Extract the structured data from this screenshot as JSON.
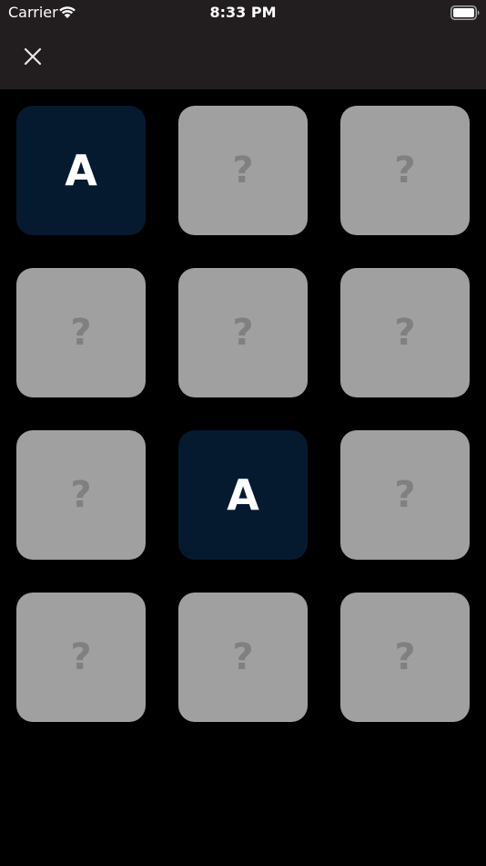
{
  "status_bar": {
    "carrier": "Carrier",
    "time": "8:33 PM",
    "wifi_icon": "wifi-icon",
    "battery_icon": "battery-icon"
  },
  "header": {
    "close_icon": "close-icon"
  },
  "colors": {
    "header_bg": "#221e1f",
    "page_bg": "#000000",
    "hidden_card": "#a0a0a0",
    "hidden_mark": "#808080",
    "revealed_card": "#061a2f",
    "revealed_text": "#ffffff"
  },
  "board": {
    "rows": 4,
    "columns": 3,
    "cards": [
      {
        "face": "A",
        "state": "revealed"
      },
      {
        "face": "?",
        "state": "hidden"
      },
      {
        "face": "?",
        "state": "hidden"
      },
      {
        "face": "?",
        "state": "hidden"
      },
      {
        "face": "?",
        "state": "hidden"
      },
      {
        "face": "?",
        "state": "hidden"
      },
      {
        "face": "?",
        "state": "hidden"
      },
      {
        "face": "A",
        "state": "revealed"
      },
      {
        "face": "?",
        "state": "hidden"
      },
      {
        "face": "?",
        "state": "hidden"
      },
      {
        "face": "?",
        "state": "hidden"
      },
      {
        "face": "?",
        "state": "hidden"
      }
    ]
  }
}
